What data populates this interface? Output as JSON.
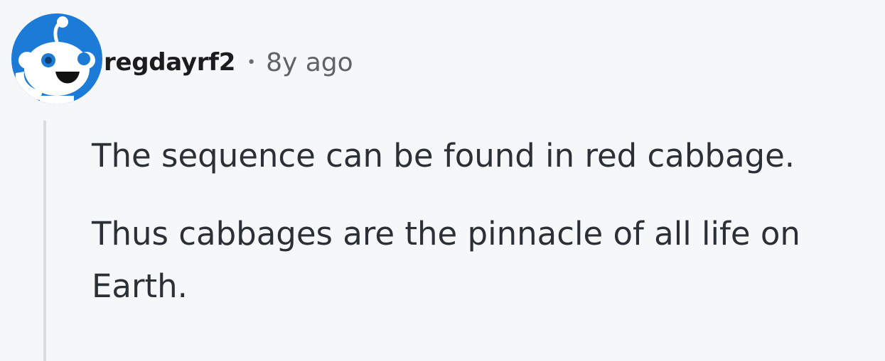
{
  "comment": {
    "author": "regdayrf2",
    "separator": "•",
    "timestamp": "8y ago",
    "avatar_icon": "reddit-snoo-avatar-icon",
    "paragraphs": [
      "The sequence can be found in red cabbage.",
      "Thus cabbages are the pinnacle of all life on Earth."
    ]
  },
  "colors": {
    "avatar_background": "#1b7bd6",
    "thread_line": "#d9dde2",
    "text": "#2a3036",
    "meta": "#5f6368"
  }
}
